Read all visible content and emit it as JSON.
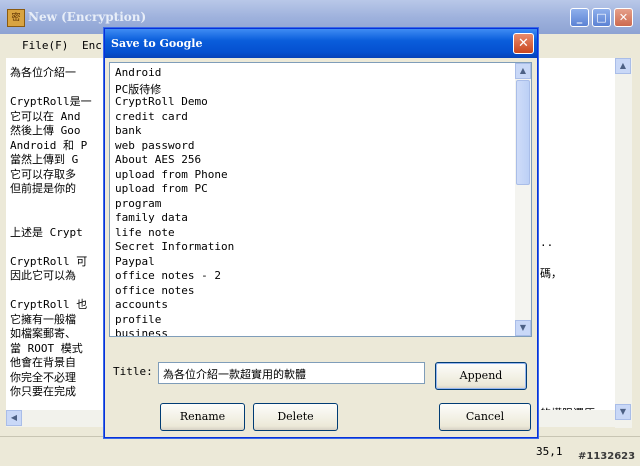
{
  "main_window": {
    "title": "New (Encryption)",
    "icon_char": "密",
    "menu": {
      "file": "File(F)",
      "enc": "Enc"
    },
    "editor_lines": [
      "為各位介紹一",
      "",
      "CryptRoll是一",
      "它可以在 And",
      "然後上傳 Goo",
      "Android 和 P",
      "當然上傳到 G",
      "它可以存取多",
      "但前提是你的",
      "",
      "",
      "上述是 Crypt",
      "",
      "CryptRoll 可",
      "因此它可以為",
      "",
      "CryptRoll 也",
      "它擁有一般檔",
      "如檔案郵寄、",
      "當 ROOT 模式",
      "他會在背景自",
      "你完全不必理",
      "你只要在完成"
    ],
    "editor_right_fragments": {
      "line_11": "..",
      "line_13": "碼，",
      "line_22": "的權限還原"
    },
    "status_position": "35,1",
    "watermark": "#1132623"
  },
  "dialog": {
    "title": "Save to Google",
    "close_glyph": "✕",
    "items": [
      "Android",
      "PC版待修",
      "CryptRoll Demo",
      "credit card",
      "bank",
      "web password",
      "About AES 256",
      "upload from Phone",
      "upload from PC",
      "program",
      "family data",
      "life note",
      "Secret Information",
      "Paypal",
      "office notes - 2",
      "office notes",
      "accounts",
      "profile",
      "business"
    ],
    "title_label": "Title:",
    "title_value": "為各位介紹一款超實用的軟體",
    "buttons": {
      "append": "Append",
      "rename": "Rename",
      "delete": "Delete",
      "cancel": "Cancel"
    }
  }
}
